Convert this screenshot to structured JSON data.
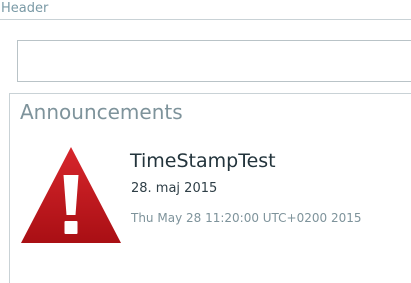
{
  "header": {
    "title": "Header"
  },
  "input": {
    "value": ""
  },
  "announcements": {
    "title": "Announcements",
    "items": [
      {
        "icon": "warning-icon",
        "title": "TimeStampTest",
        "date": "28. maj 2015",
        "timestamp": "Thu May 28 11:20:00 UTC+0200 2015"
      }
    ]
  },
  "colors": {
    "warning_red": "#c0191f",
    "label_gray": "#7e939b",
    "text_dark": "#23343c"
  }
}
